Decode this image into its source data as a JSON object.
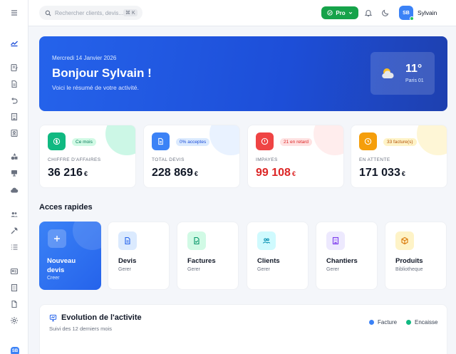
{
  "topbar": {
    "search_placeholder": "Rechercher clients, devis...",
    "search_shortcut": "⌘ K",
    "plan_label": "Pro",
    "user_initials": "SB",
    "user_name": "Sylvain"
  },
  "sidebar": {
    "avatar_initials": "SB",
    "icons": [
      "menu-icon",
      "chart-icon",
      "quote-edit-icon",
      "document-icon",
      "undo-icon",
      "building-icon",
      "contact-card-icon",
      "shapes-icon",
      "monitor-icon",
      "cloud-icon",
      "users-icon",
      "wrench-icon",
      "list-icon",
      "id-card-icon",
      "building-2-icon",
      "file-icon",
      "settings-icon"
    ]
  },
  "hero": {
    "date": "Mercredi 14 Janvier 2026",
    "title": "Bonjour Sylvain !",
    "subtitle": "Voici le résumé de votre activité.",
    "weather_temp": "11°",
    "weather_city": "Paris 01"
  },
  "stats": [
    {
      "label": "CHIFFRE D'AFFAIRES",
      "value": "36 216",
      "currency": "€",
      "badge": "Ce mois",
      "icon": "dollar-icon",
      "color": "#10b981"
    },
    {
      "label": "TOTAL DEVIS",
      "value": "228 869",
      "currency": "€",
      "badge": "0% acceptes",
      "icon": "document-icon",
      "color": "#3b82f6"
    },
    {
      "label": "IMPAYES",
      "value": "99 108",
      "currency": "€",
      "badge": "21 en retard",
      "icon": "alert-icon",
      "color": "#ef4444"
    },
    {
      "label": "EN ATTENTE",
      "value": "171 033",
      "currency": "€",
      "badge": "33 facture(s)",
      "icon": "clock-icon",
      "color": "#f59e0b"
    }
  ],
  "quick_access": {
    "title": "Acces rapides",
    "items": [
      {
        "label": "Nouveau devis",
        "sub": "Creer",
        "icon": "plus-icon"
      },
      {
        "label": "Devis",
        "sub": "Gerer",
        "icon": "document-icon"
      },
      {
        "label": "Factures",
        "sub": "Gerer",
        "icon": "invoice-icon"
      },
      {
        "label": "Clients",
        "sub": "Gerer",
        "icon": "users-icon"
      },
      {
        "label": "Chantiers",
        "sub": "Gerer",
        "icon": "building-icon"
      },
      {
        "label": "Produits",
        "sub": "Bibliotheque",
        "icon": "box-icon"
      }
    ]
  },
  "activity": {
    "title": "Evolution de l'activite",
    "subtitle": "Suivi des 12 derniers mois",
    "legend": [
      {
        "name": "Facture",
        "color": "#3b82f6"
      },
      {
        "name": "Encaisse",
        "color": "#10b981"
      }
    ]
  }
}
